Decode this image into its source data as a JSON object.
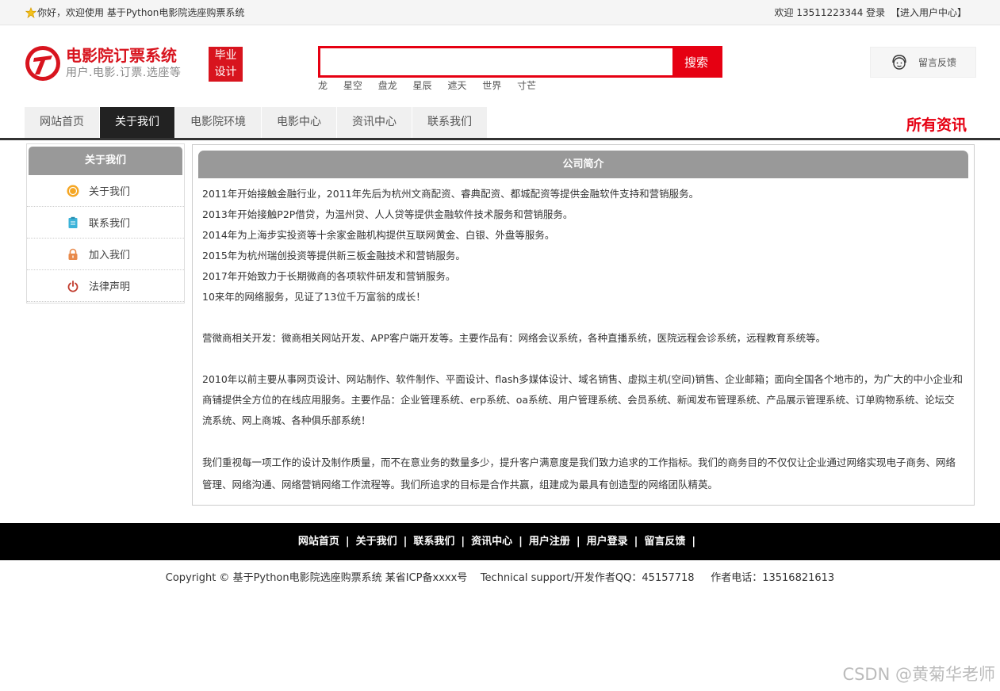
{
  "topbar": {
    "greeting": "你好，欢迎使用 基于Python电影院选座购票系统",
    "welcome": "欢迎 13511223344 登录",
    "user_center": "【进入用户中心】"
  },
  "header": {
    "title": "电影院订票系统",
    "subtitle": "用户.电影.订票.选座等",
    "badge_line1": "毕业",
    "badge_line2": "设计",
    "search_placeholder": "",
    "search_button": "搜索",
    "hot_keywords": [
      "龙",
      "星空",
      "盘龙",
      "星辰",
      "遮天",
      "世界",
      "寸芒"
    ],
    "feedback": "留言反馈"
  },
  "nav": {
    "items": [
      "网站首页",
      "关于我们",
      "电影院环境",
      "电影中心",
      "资讯中心",
      "联系我们"
    ],
    "active_index": 1,
    "right_label": "所有资讯"
  },
  "sidebar": {
    "title": "关于我们",
    "items": [
      {
        "label": "关于我们",
        "icon": "coin-icon"
      },
      {
        "label": "联系我们",
        "icon": "clipboard-icon"
      },
      {
        "label": "加入我们",
        "icon": "lock-icon"
      },
      {
        "label": "法律声明",
        "icon": "power-icon"
      }
    ]
  },
  "main": {
    "title": "公司简介",
    "paragraphs": [
      "2011年开始接触金融行业，2011年先后为杭州文商配资、睿典配资、都城配资等提供金融软件支持和营销服务。",
      "2013年开始接触P2P借贷，为温州贷、人人贷等提供金融软件技术服务和营销服务。",
      "2014年为上海步实投资等十余家金融机构提供互联网黄金、白银、外盘等服务。",
      "2015年为杭州瑞创投资等提供新三板金融技术和营销服务。",
      "2017年开始致力于长期微商的各项软件研发和营销服务。",
      "10来年的网络服务，见证了13位千万富翁的成长！",
      "",
      "营微商相关开发：微商相关网站开发、APP客户端开发等。主要作品有：网络会议系统，各种直播系统，医院远程会诊系统，远程教育系统等。",
      "",
      "2010年以前主要从事网页设计、网站制作、软件制作、平面设计、flash多媒体设计、域名销售、虚拟主机(空间)销售、企业邮箱；面向全国各个地市的，为广大的中小企业和商铺提供全方位的在线应用服务。主要作品：企业管理系统、erp系统、oa系统、用户管理系统、会员系统、新闻发布管理系统、产品展示管理系统、订单购物系统、论坛交流系统、网上商城、各种俱乐部系统！",
      "",
      "我们重视每一项工作的设计及制作质量，而不在意业务的数量多少，提升客户满意度是我们致力追求的工作指标。我们的商务目的不仅仅让企业通过网络实现电子商务、网络管理、网络沟通、网络营销网络工作流程等。我们所追求的目标是合作共赢，组建成为最具有创造型的网络团队精英。"
    ]
  },
  "footer": {
    "links": [
      "网站首页",
      "关于我们",
      "联系我们",
      "资讯中心",
      "用户注册",
      "用户登录",
      "留言反馈"
    ],
    "separator": "|",
    "copyright": "Copyright © 基于Python电影院选座购票系统 某省ICP备xxxx号    Technical support/开发作者QQ：45157718     作者电话：13516821613"
  },
  "watermark": "CSDN @黄菊华老师",
  "colors": {
    "brand_red": "#e60012",
    "nav_active": "#222222",
    "panel_head": "#999999"
  }
}
